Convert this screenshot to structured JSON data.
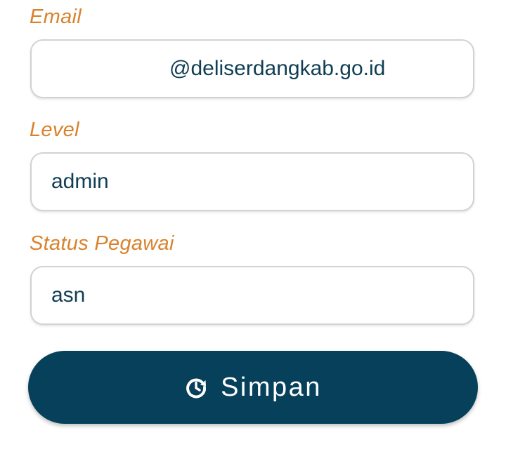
{
  "form": {
    "email": {
      "label": "Email",
      "value": "@deliserdangkab.go.id"
    },
    "level": {
      "label": "Level",
      "value": "admin"
    },
    "status_pegawai": {
      "label": "Status Pegawai",
      "value": "asn"
    },
    "submit": {
      "label": "Simpan",
      "icon": "refresh-clock-icon"
    }
  },
  "colors": {
    "label": "#d9822b",
    "text": "#0f3e55",
    "button": "#07405a",
    "border": "#cfd3d6"
  }
}
